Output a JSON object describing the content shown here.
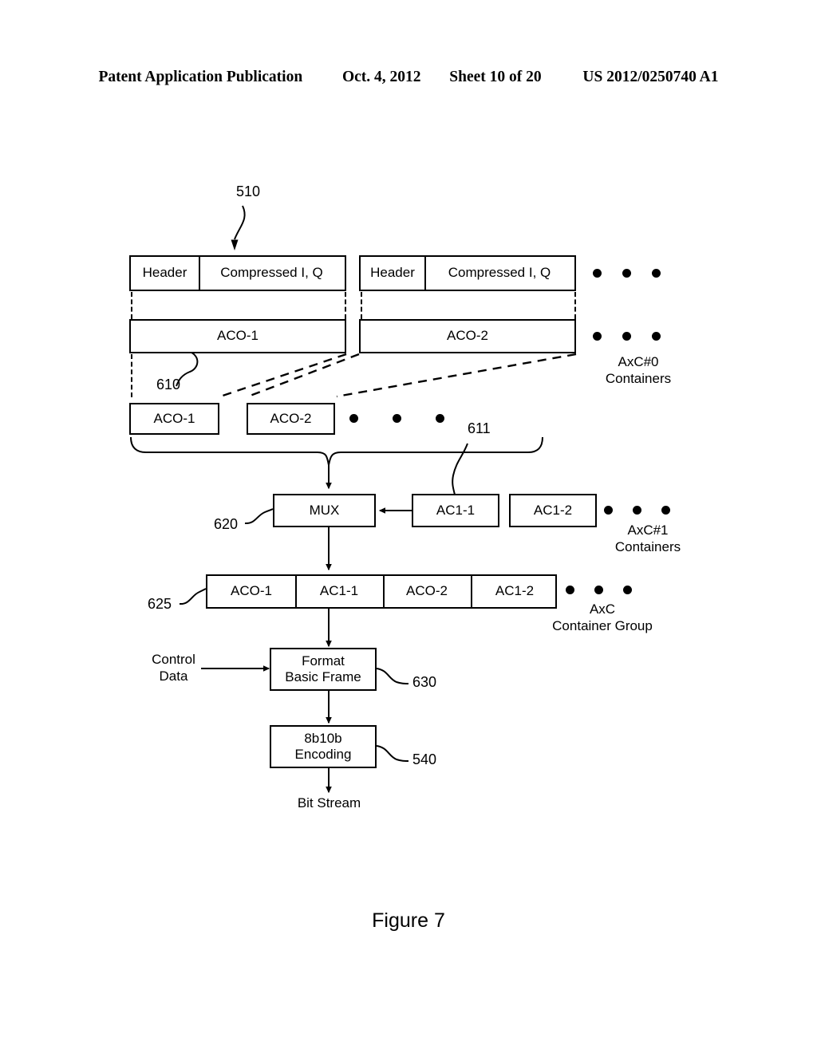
{
  "header": {
    "publication": "Patent Application Publication",
    "date": "Oct. 4, 2012",
    "sheet": "Sheet 10 of 20",
    "number": "US 2012/0250740 A1"
  },
  "figure": {
    "caption": "Figure 7"
  },
  "diagram": {
    "ref_510": "510",
    "ref_610": "610",
    "ref_611": "611",
    "ref_620": "620",
    "ref_625": "625",
    "ref_630": "630",
    "ref_540": "540",
    "frames": [
      {
        "header": "Header",
        "payload": "Compressed I, Q"
      },
      {
        "header": "Header",
        "payload": "Compressed I, Q"
      }
    ],
    "aco_wide": [
      {
        "label": "ACO-1"
      },
      {
        "label": "ACO-2"
      }
    ],
    "aco_small": [
      {
        "label": "ACO-1"
      },
      {
        "label": "ACO-2"
      }
    ],
    "axc0_label": "AxC#0\nContainers",
    "mux": {
      "label": "MUX"
    },
    "ac1_boxes": [
      {
        "label": "AC1-1"
      },
      {
        "label": "AC1-2"
      }
    ],
    "axc1_label": "AxC#1\nContainers",
    "container_group_cells": [
      {
        "label": "ACO-1"
      },
      {
        "label": "AC1-1"
      },
      {
        "label": "ACO-2"
      },
      {
        "label": "AC1-2"
      }
    ],
    "axc_group_label_line1": "AxC",
    "axc_group_label_line2": "Container Group",
    "control_data": "Control\nData",
    "format_basic_frame": "Format\nBasic Frame",
    "encoding": "8b10b\nEncoding",
    "bit_stream": "Bit Stream"
  },
  "colors": {
    "ink": "#000000",
    "paper": "#ffffff"
  }
}
